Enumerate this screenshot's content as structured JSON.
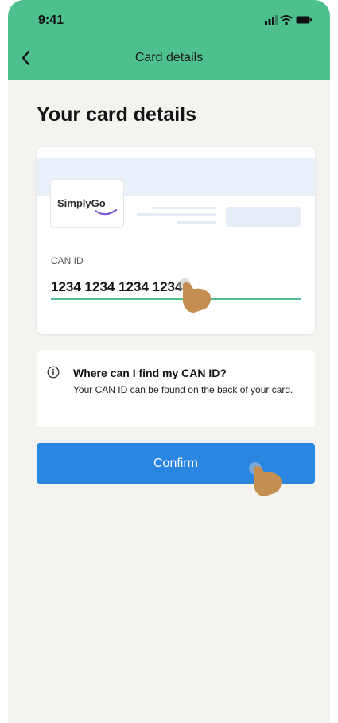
{
  "status_bar": {
    "time": "9:41"
  },
  "nav": {
    "title": "Card details"
  },
  "page": {
    "title": "Your card details"
  },
  "card": {
    "brand": "SimplyGo",
    "can_label": "CAN ID",
    "can_value": "1234 1234 1234 1234"
  },
  "info": {
    "title": "Where can I find my CAN ID?",
    "body": "Your CAN ID can be found on the back of your card."
  },
  "confirm": {
    "label": "Confirm"
  },
  "colors": {
    "header": "#4dc08e",
    "accent": "#2a86e0",
    "background": "#f4f3f0",
    "underline": "#4dc08e"
  },
  "icons": [
    "signal-icon",
    "wifi-icon",
    "battery-icon",
    "back-icon",
    "info-icon",
    "tap-hand-icon"
  ]
}
